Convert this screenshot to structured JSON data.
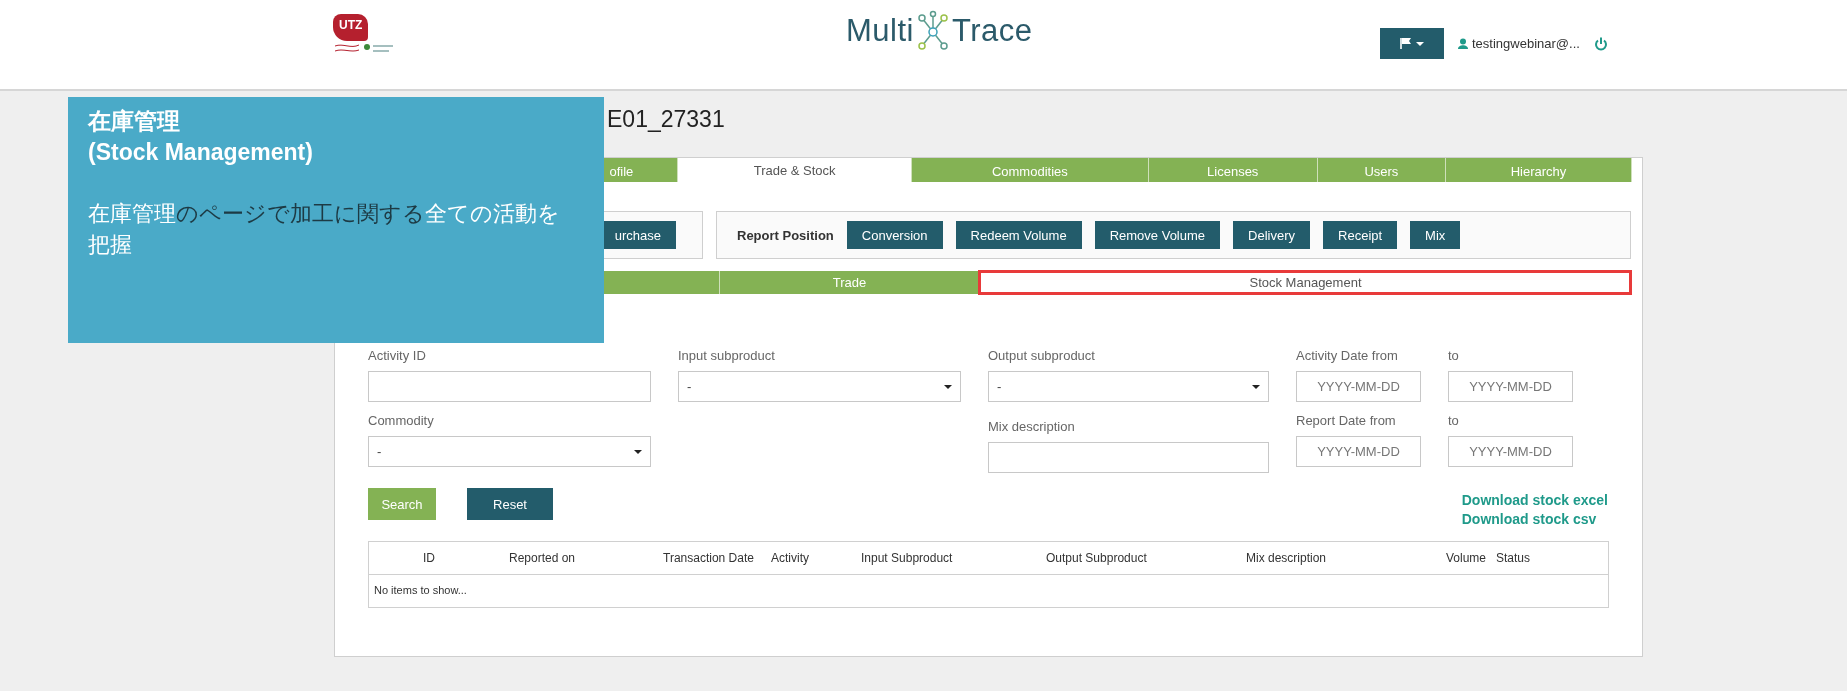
{
  "header": {
    "partner_logo": "UTZ",
    "brand": {
      "left": "Multi",
      "right": "Trace"
    },
    "user": "testingwebinar@..."
  },
  "page_title": "E01_27331",
  "tabs": [
    {
      "label": "ofile",
      "selected": false
    },
    {
      "label": "Trade & Stock",
      "selected": true
    },
    {
      "label": "Commodities",
      "selected": false
    },
    {
      "label": "Licenses",
      "selected": false
    },
    {
      "label": "Users",
      "selected": false
    },
    {
      "label": "Hierarchy",
      "selected": false
    }
  ],
  "action_groups": [
    {
      "buttons": [
        "urchase"
      ]
    },
    {
      "label": "Report Position",
      "buttons": [
        "Conversion",
        "Redeem Volume",
        "Remove Volume",
        "Delivery",
        "Receipt",
        "Mix"
      ]
    }
  ],
  "subtabs": [
    {
      "selected": false,
      "highlighted": false
    },
    {
      "label": "Trade",
      "selected": false,
      "highlighted": false
    },
    {
      "label": "Stock Management",
      "selected": true,
      "highlighted": true
    }
  ],
  "filters": [
    {
      "label": "Activity ID",
      "kind": "text"
    },
    {
      "label": "Input subproduct",
      "kind": "select",
      "value": "-"
    },
    {
      "label": "Output subproduct",
      "kind": "select",
      "value": "-"
    },
    {
      "label": "Activity Date from",
      "kind": "date",
      "placeholder": "YYYY-MM-DD"
    },
    {
      "label": "to",
      "kind": "date",
      "placeholder": "YYYY-MM-DD"
    },
    {
      "label": "Commodity",
      "kind": "select",
      "value": "-"
    },
    {
      "label": "Mix description",
      "kind": "text"
    },
    {
      "label": "Report Date from",
      "kind": "date",
      "placeholder": "YYYY-MM-DD"
    },
    {
      "label": "to",
      "kind": "date",
      "placeholder": "YYYY-MM-DD"
    }
  ],
  "buttons": [
    {
      "label": "Search",
      "kind": "primary"
    },
    {
      "label": "Reset",
      "kind": "secondary"
    }
  ],
  "downloads": [
    "Download stock excel",
    "Download stock csv"
  ],
  "table": {
    "columns": [
      "ID",
      "Reported on",
      "Transaction Date",
      "Activity",
      "Input Subproduct",
      "Output Subproduct",
      "Mix description",
      "Volume",
      "Status"
    ],
    "empty_text": "No items to show..."
  },
  "overlay": {
    "title": "在庫管理",
    "subtitle": "(Stock Management)",
    "body": [
      {
        "text": "在庫管理",
        "emphasis": true
      },
      {
        "text": "のページで加工に関する",
        "emphasis": false
      },
      {
        "text": "全ての",
        "emphasis": true
      },
      {
        "text": "活動を把握",
        "emphasis": true
      }
    ]
  }
}
